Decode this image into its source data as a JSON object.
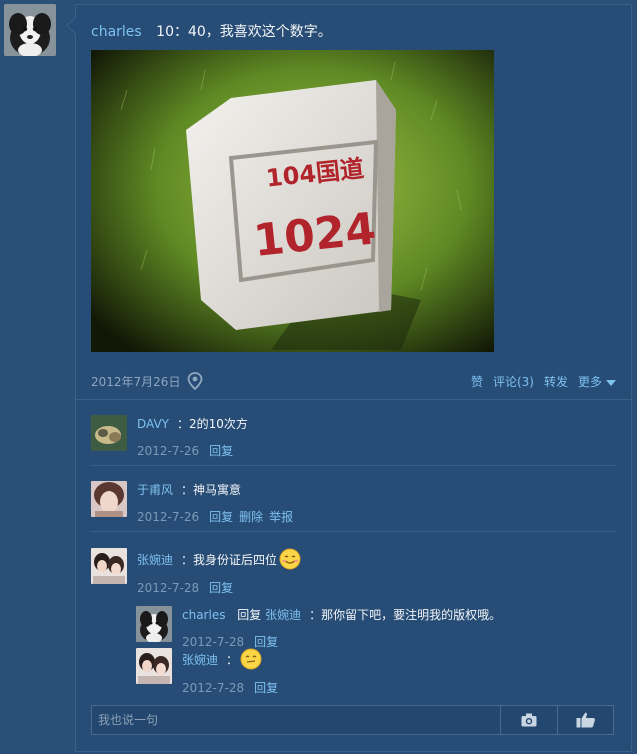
{
  "post": {
    "author": "charles",
    "text": "10：40，我喜欢这个数字。",
    "photo": {
      "top_label": "104国道",
      "number": "1024"
    },
    "date": "2012年7月26日",
    "actions": {
      "like": "赞",
      "comment": "评论(3)",
      "forward": "转发",
      "more": "更多"
    }
  },
  "comments": [
    {
      "name": "DAVY",
      "text": "：2的10次方",
      "date": "2012-7-26",
      "links": [
        "回复"
      ]
    },
    {
      "name": "于甫风",
      "text": "：神马寓意",
      "date": "2012-7-26",
      "links": [
        "回复",
        "删除",
        "举报"
      ]
    },
    {
      "name": "张婉迪",
      "text": "：我身份证后四位",
      "date": "2012-7-28",
      "links": [
        "回复"
      ]
    }
  ],
  "replies": [
    {
      "name": "charles",
      "reply_word": "回复",
      "target": "张婉迪",
      "text": "：那你留下吧，要注明我的版权哦。",
      "date": "2012-7-28",
      "link": "回复"
    },
    {
      "name": "张婉迪",
      "text": "：",
      "date": "2012-7-28",
      "link": "回复"
    }
  ],
  "input": {
    "placeholder": "我也说一句"
  },
  "icons": {
    "location": "location-pin-icon",
    "camera": "camera-icon",
    "thumbs": "thumbs-up-icon",
    "emoji": "smile-emoji-icon",
    "caret": "caret-down-icon"
  },
  "colors": {
    "background": "#2b5078",
    "card": "#274c75",
    "link": "#7ec1f0",
    "date": "#7c9ab8"
  }
}
